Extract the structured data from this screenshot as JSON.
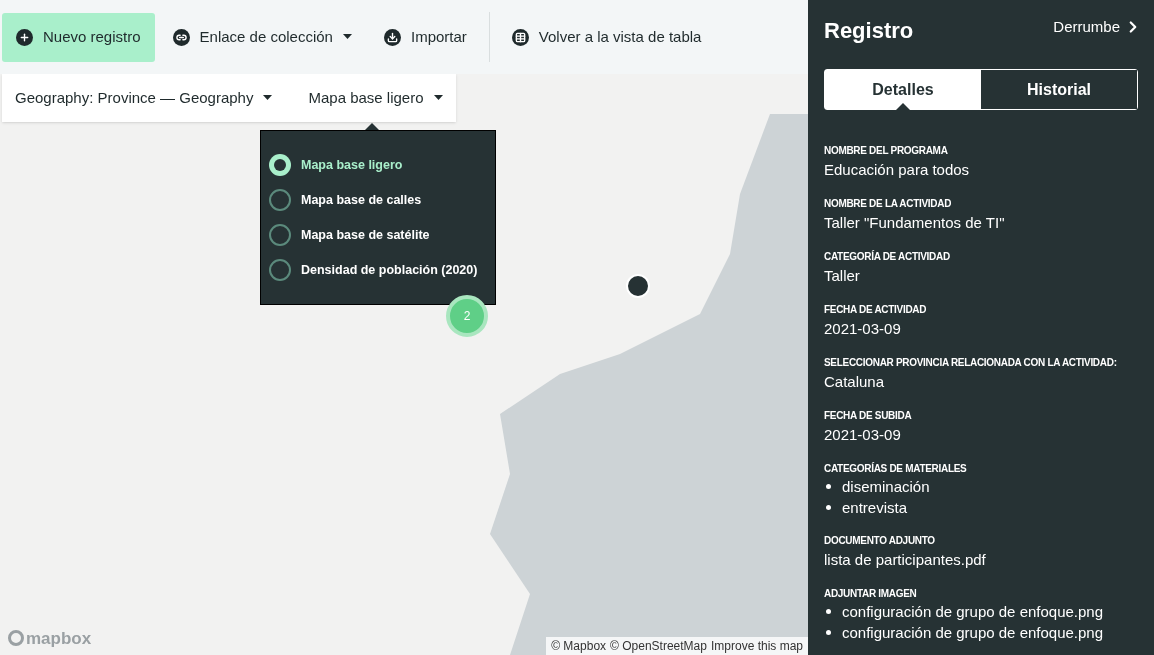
{
  "toolbar": {
    "buttons": [
      {
        "label": "Nuevo registro",
        "highlighted": true,
        "has_menu": false
      },
      {
        "label": "Enlace de colección",
        "highlighted": false,
        "has_menu": true
      },
      {
        "label": "Importar",
        "highlighted": false,
        "has_menu": false
      },
      {
        "label": "Volver a la vista de tabla",
        "highlighted": false,
        "has_menu": false
      }
    ]
  },
  "map": {
    "geography_filter": "Geography: Province — Geography",
    "basemap_select": "Mapa base ligero",
    "basemap_menu": {
      "expanded": true,
      "options": [
        {
          "label": "Mapa base ligero",
          "selected": true
        },
        {
          "label": "Mapa base de calles",
          "selected": false
        },
        {
          "label": "Mapa base de satélite",
          "selected": false
        },
        {
          "label": "Densidad de población (2020)",
          "selected": false
        }
      ]
    },
    "markers": [
      {
        "kind": "cluster",
        "count": "2"
      },
      {
        "kind": "point"
      }
    ],
    "logo": "mapbox",
    "attribution": [
      "© Mapbox",
      "© OpenStreetMap",
      "Improve this map"
    ]
  },
  "sidebar": {
    "title": "Registro",
    "collapse_link": "Derrumbe",
    "tabs": [
      {
        "label": "Detalles",
        "selected": true
      },
      {
        "label": "Historial",
        "selected": false
      }
    ],
    "fields": [
      {
        "kind": "text",
        "label": "NOMBRE DEL PROGRAMA",
        "value": "Educación para todos"
      },
      {
        "kind": "text",
        "label": "NOMBRE DE LA ACTIVIDAD",
        "value": "Taller \"Fundamentos de TI\""
      },
      {
        "kind": "text",
        "label": "CATEGORÍA DE ACTIVIDAD",
        "value": "Taller"
      },
      {
        "kind": "text",
        "label": "FECHA DE ACTIVIDAD",
        "value": "2021-03-09"
      },
      {
        "kind": "text",
        "label": "SELECCIONAR PROVINCIA RELACIONADA CON LA ACTIVIDAD:",
        "value": "Cataluna"
      },
      {
        "kind": "text",
        "label": "FECHA DE SUBIDA",
        "value": "2021-03-09"
      },
      {
        "kind": "list",
        "label": "CATEGORÍAS DE MATERIALES",
        "values": [
          "diseminación",
          "entrevista"
        ]
      },
      {
        "kind": "text",
        "label": "DOCUMENTO ADJUNTO",
        "value": "lista de participantes.pdf"
      },
      {
        "kind": "list",
        "label": "ADJUNTAR IMAGEN",
        "values": [
          "configuración de grupo de enfoque.png",
          "configuración de grupo de enfoque.png"
        ]
      }
    ]
  }
}
